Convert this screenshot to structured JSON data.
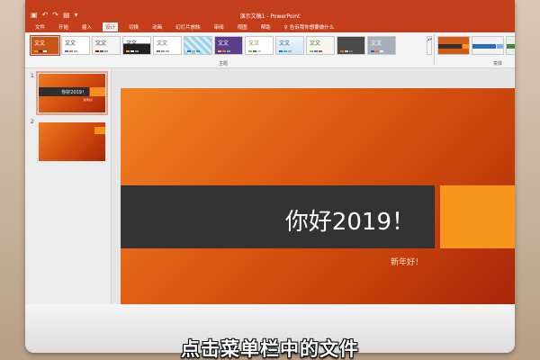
{
  "titlebar": {
    "doc_title": "演示文稿1 - PowerPoint",
    "qa_icons": [
      "save-icon",
      "undo-icon",
      "redo-icon",
      "start-from-beginning-icon",
      "customize-icon"
    ]
  },
  "tabs": [
    {
      "label": "文件"
    },
    {
      "label": "开始"
    },
    {
      "label": "插入"
    },
    {
      "label": "设计"
    },
    {
      "label": "切换"
    },
    {
      "label": "动画"
    },
    {
      "label": "幻灯片放映"
    },
    {
      "label": "审阅"
    },
    {
      "label": "视图"
    },
    {
      "label": "帮助"
    },
    {
      "label": "告诉我你想要做什么"
    }
  ],
  "ribbon": {
    "themes_group_label": "主题",
    "variants_group_label": "变体",
    "theme_sample_text": "文文"
  },
  "slides_panel": {
    "numbers": [
      "1",
      "2"
    ],
    "slide1_title": "你好2019！",
    "slide1_sub": "新年好！"
  },
  "slide": {
    "title": "你好2019！",
    "subtitle": "新年好！"
  },
  "caption": "点击菜单栏中的文件",
  "colors": {
    "accent": "#c43e1c",
    "slide_orange": "#e0601a",
    "band": "#333333",
    "square": "#f7951d"
  }
}
